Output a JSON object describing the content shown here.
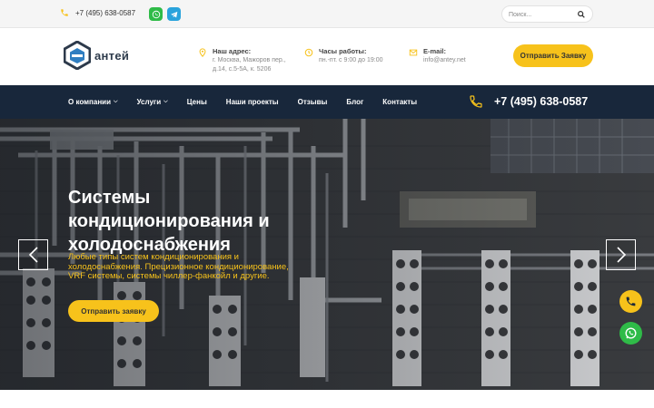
{
  "topbar": {
    "phone": "+7 (495) 638-0587",
    "whatsapp_icon": "whatsapp-icon",
    "telegram_icon": "telegram-icon",
    "search_placeholder": "Поиск...",
    "search_icon": "search-icon"
  },
  "header": {
    "logo_text": "антей",
    "address": {
      "title": "Наш адрес:",
      "text": "г. Москва, Мажоров пер., д.14, с.5-5А, к. 5206"
    },
    "hours": {
      "title": "Часы работы:",
      "text": "пн.-пт. с 9:00 до 19:00"
    },
    "email": {
      "title": "E-mail:",
      "text": "info@antey.net"
    },
    "cta_label": "Отправить Заявку"
  },
  "nav": {
    "items": [
      {
        "label": "О компании",
        "dropdown": true
      },
      {
        "label": "Услуги",
        "dropdown": true
      },
      {
        "label": "Цены",
        "dropdown": false
      },
      {
        "label": "Наши проекты",
        "dropdown": false
      },
      {
        "label": "Отзывы",
        "dropdown": false
      },
      {
        "label": "Блог",
        "dropdown": false
      },
      {
        "label": "Контакты",
        "dropdown": false
      }
    ],
    "phone": "+7 (495) 638-0587"
  },
  "hero": {
    "title": "Системы кондиционирования и холодоснабжения",
    "description": "Любые типы систем кондиционирования и холодоснабжения. Прецизионное кондиционирование, VRF системы, системы чиллер-фанкойл и другие.",
    "button_label": "Отправить заявку"
  },
  "colors": {
    "accent": "#f7c21b",
    "nav_bg": "#18273b",
    "whatsapp": "#2fbb48",
    "telegram": "#2aa3dc"
  }
}
